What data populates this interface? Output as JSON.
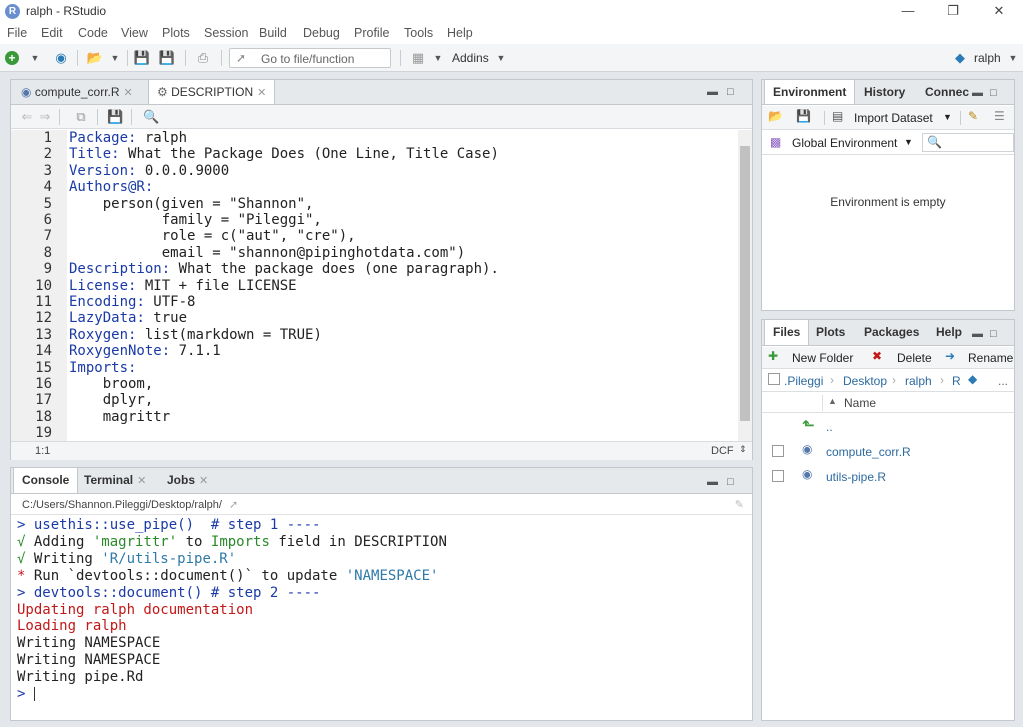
{
  "window": {
    "title": "ralph - RStudio",
    "r_glyph": "R"
  },
  "menu": [
    "File",
    "Edit",
    "Code",
    "View",
    "Plots",
    "Session",
    "Build",
    "Debug",
    "Profile",
    "Tools",
    "Help"
  ],
  "toolbar": {
    "goto_placeholder": "Go to file/function",
    "addins": "Addins",
    "project": "ralph"
  },
  "editor": {
    "tabs": [
      "compute_corr.R",
      "DESCRIPTION"
    ],
    "active_tab": "DESCRIPTION",
    "cursor": "1:1",
    "filetype": "DCF",
    "lines": [
      {
        "n": "1",
        "key": "Package",
        "val": " ralph"
      },
      {
        "n": "2",
        "key": "Title",
        "val": " What the Package Does (One Line, Title Case)"
      },
      {
        "n": "3",
        "key": "Version",
        "val": " 0.0.0.9000"
      },
      {
        "n": "4",
        "key": "Authors@R",
        "val": ""
      },
      {
        "n": "5",
        "key": "",
        "val": "    person(given = \"Shannon\","
      },
      {
        "n": "6",
        "key": "",
        "val": "           family = \"Pileggi\","
      },
      {
        "n": "7",
        "key": "",
        "val": "           role = c(\"aut\", \"cre\"),"
      },
      {
        "n": "8",
        "key": "",
        "val": "           email = \"shannon@pipinghotdata.com\")"
      },
      {
        "n": "9",
        "key": "Description",
        "val": " What the package does (one paragraph)."
      },
      {
        "n": "10",
        "key": "License",
        "val": " MIT + file LICENSE"
      },
      {
        "n": "11",
        "key": "Encoding",
        "val": " UTF-8"
      },
      {
        "n": "12",
        "key": "LazyData",
        "val": " true"
      },
      {
        "n": "13",
        "key": "Roxygen",
        "val": " list(markdown = TRUE)"
      },
      {
        "n": "14",
        "key": "RoxygenNote",
        "val": " 7.1.1"
      },
      {
        "n": "15",
        "key": "Imports",
        "val": ""
      },
      {
        "n": "16",
        "key": "",
        "val": "    broom,"
      },
      {
        "n": "17",
        "key": "",
        "val": "    dplyr,"
      },
      {
        "n": "18",
        "key": "",
        "val": "    magrittr"
      },
      {
        "n": "19",
        "key": "",
        "val": ""
      }
    ]
  },
  "console": {
    "tabs": [
      "Console",
      "Terminal",
      "Jobs"
    ],
    "path": "C:/Users/Shannon.Pileggi/Desktop/ralph/",
    "lines": [
      [
        {
          "t": "> usethis::use_pipe()  # step 1 ----",
          "c": "blue"
        }
      ],
      [
        {
          "t": "√ ",
          "c": "green"
        },
        {
          "t": "Adding ",
          "c": "dark"
        },
        {
          "t": "'magrittr'",
          "c": "green"
        },
        {
          "t": " to ",
          "c": "dark"
        },
        {
          "t": "Imports",
          "c": "green"
        },
        {
          "t": " field in DESCRIPTION",
          "c": "dark"
        }
      ],
      [
        {
          "t": "√ ",
          "c": "green"
        },
        {
          "t": "Writing ",
          "c": "dark"
        },
        {
          "t": "'R/utils-pipe.R'",
          "c": "teal"
        }
      ],
      [
        {
          "t": "* ",
          "c": "red"
        },
        {
          "t": "Run `devtools::document()` to update ",
          "c": "dark"
        },
        {
          "t": "'NAMESPACE'",
          "c": "teal"
        }
      ],
      [
        {
          "t": "> devtools::document() # step 2 ----",
          "c": "blue"
        }
      ],
      [
        {
          "t": "Updating ralph documentation",
          "c": "red"
        }
      ],
      [
        {
          "t": "Loading ralph",
          "c": "red"
        }
      ],
      [
        {
          "t": "Writing NAMESPACE",
          "c": "dark"
        }
      ],
      [
        {
          "t": "Writing NAMESPACE",
          "c": "dark"
        }
      ],
      [
        {
          "t": "Writing pipe.Rd",
          "c": "dark"
        }
      ],
      [
        {
          "t": "> ",
          "c": "blue"
        }
      ]
    ]
  },
  "environment": {
    "tabs": [
      "Environment",
      "History",
      "Connec"
    ],
    "import_label": "Import Dataset",
    "scope": "Global Environment",
    "empty_message": "Environment is empty"
  },
  "files": {
    "tabs": [
      "Files",
      "Plots",
      "Packages",
      "Help"
    ],
    "actions": [
      "New Folder",
      "Delete",
      "Rename"
    ],
    "breadcrumb": [
      ".Pileggi",
      "Desktop",
      "ralph",
      "R"
    ],
    "more": "...",
    "column": "Name",
    "up": "..",
    "items": [
      "compute_corr.R",
      "utils-pipe.R"
    ]
  },
  "colors": {
    "accent": "#1a3aa8",
    "error": "#c21818",
    "success": "#2a8a2a"
  }
}
